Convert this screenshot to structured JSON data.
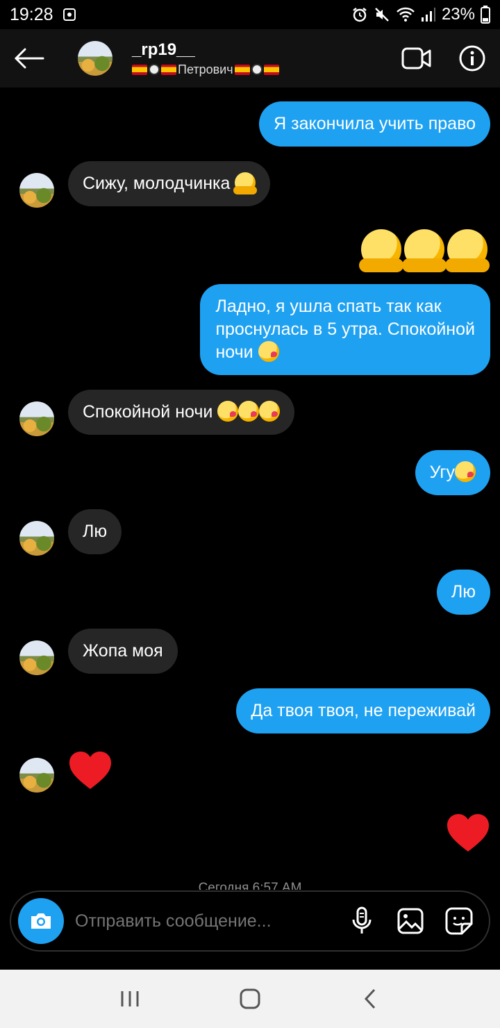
{
  "status": {
    "time": "19:28",
    "battery": "23%"
  },
  "header": {
    "name": "_rp19__",
    "subtitle": "Петрович"
  },
  "messages": [
    {
      "from": "me",
      "text": "Я закончила учить право"
    },
    {
      "from": "them",
      "text": "Сижу, молодчинка",
      "emoji": "hugging-face"
    },
    {
      "from": "me",
      "emoji_only": [
        "hugging-face",
        "hugging-face",
        "hugging-face"
      ]
    },
    {
      "from": "me",
      "lines": [
        "Ладно, я ушла спать так как",
        "проснулась в 5 утра. Спокойной",
        "ночи"
      ],
      "emoji": "kiss-face"
    },
    {
      "from": "them",
      "text": "Спокойной ночи",
      "emoji": [
        "kiss-face",
        "kiss-face",
        "kiss-face"
      ]
    },
    {
      "from": "me",
      "text": "Угу",
      "emoji": "kiss-face"
    },
    {
      "from": "them",
      "text": "Лю"
    },
    {
      "from": "me",
      "text": "Лю"
    },
    {
      "from": "them",
      "text": "Жопа моя"
    },
    {
      "from": "me",
      "text": "Да твоя твоя, не переживай"
    },
    {
      "from": "them",
      "emoji_only": [
        "red-heart"
      ]
    },
    {
      "from": "me",
      "emoji_only": [
        "red-heart"
      ]
    }
  ],
  "timestamp": "Сегодня 6:57 AM",
  "composer": {
    "placeholder": "Отправить сообщение..."
  },
  "colors": {
    "my_bubble": "#1fa1f2",
    "their_bubble": "#262626",
    "background": "#000000",
    "heart": "#ed1c24"
  }
}
